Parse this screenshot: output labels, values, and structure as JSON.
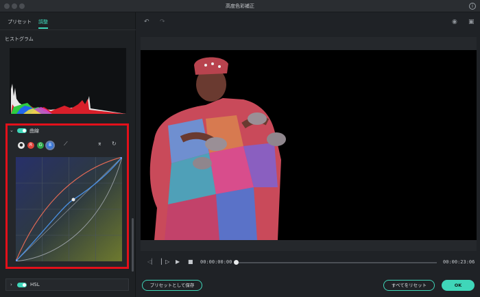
{
  "window": {
    "title": "高度色彩補正"
  },
  "tabs": [
    {
      "label": "プリセット"
    },
    {
      "label": "調整"
    }
  ],
  "histogram": {
    "label": "ヒストグラム"
  },
  "curves": {
    "label": "曲線",
    "enabled": true,
    "channels": [
      {
        "label": "",
        "color": "#e8e8e8"
      },
      {
        "label": "R",
        "color": "#e0443a"
      },
      {
        "label": "G",
        "color": "#2fa84a"
      },
      {
        "label": "B",
        "color": "#3a78d8"
      }
    ],
    "active_channel": "B"
  },
  "hsl": {
    "label": "HSL",
    "enabled": true
  },
  "playback": {
    "current_time": "00:00:00:00",
    "total_time": "00:00:23:06",
    "progress": 0.0
  },
  "buttons": {
    "save_preset": "プリセットとして保存",
    "reset_all": "すべてをリセット",
    "ok": "OK"
  },
  "colors": {
    "accent": "#3fd6b9",
    "highlight_box": "#e3101a"
  }
}
